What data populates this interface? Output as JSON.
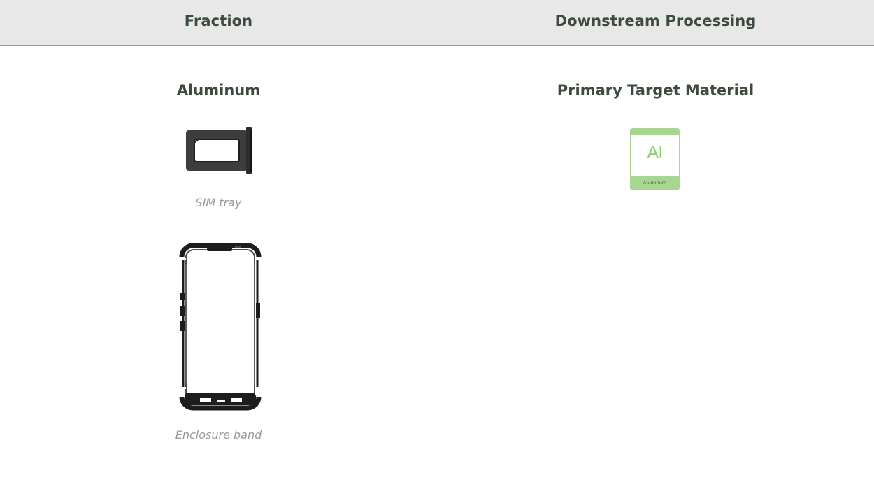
{
  "table": {
    "headers": [
      "Fraction",
      "Downstream Processing"
    ]
  },
  "fraction": {
    "title": "Aluminum",
    "components": [
      {
        "caption": "SIM tray",
        "icon": "sim-tray-drawing"
      },
      {
        "caption": "Enclosure band",
        "icon": "enclosure-band-drawing"
      }
    ]
  },
  "processing": {
    "title": "Primary Target Material",
    "material": {
      "symbol": "Al",
      "name": "Aluminum",
      "color": "#a6d68f"
    }
  }
}
